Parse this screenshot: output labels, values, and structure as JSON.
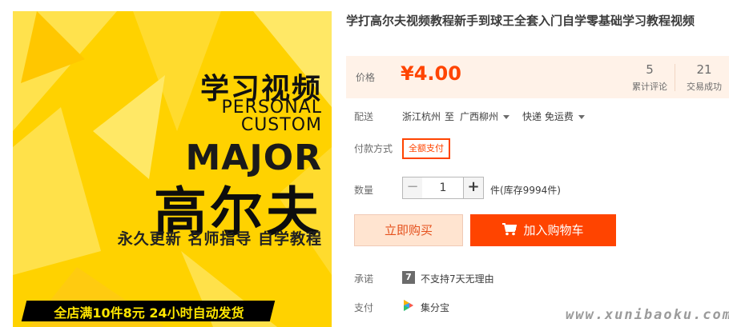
{
  "product_image": {
    "title_cn": "学习视频",
    "title_en_1": "PERSONAL",
    "title_en_2": "CUSTOM",
    "major": "MAJOR",
    "subject": "高尔夫",
    "slogan": "永久更新  名师指导  自学教程",
    "banner": "全店满10件8元  24小时自动发货",
    "colors": {
      "background": "#ffd200",
      "banner": "#000000",
      "banner_text": "#ffe600"
    }
  },
  "product": {
    "title": "学打高尔夫视频教程新手到球王全套入门自学零基础学习教程视频",
    "price_label": "价格",
    "price": "¥4.00",
    "reviews_count": "5",
    "reviews_label": "累计评论",
    "sales_count": "21",
    "sales_label": "交易成功"
  },
  "delivery": {
    "label": "配送",
    "from": "浙江杭州",
    "to_word": "至",
    "to": "广西柳州",
    "method": "快递 免运费"
  },
  "payment_method": {
    "label": "付款方式",
    "option": "全额支付"
  },
  "quantity": {
    "label": "数量",
    "minus": "−",
    "value": "1",
    "plus": "+",
    "stock": "件(库存9994件)"
  },
  "actions": {
    "buy_now": "立即购买",
    "add_to_cart": "加入购物车"
  },
  "promise": {
    "label": "承诺",
    "icon_text": "7",
    "text": "不支持7天无理由"
  },
  "pay": {
    "label": "支付",
    "text": "集分宝"
  },
  "watermark": "www.xunibaoku.com",
  "colors": {
    "accent": "#ff4400",
    "price_panel_bg": "#fff2e8"
  }
}
